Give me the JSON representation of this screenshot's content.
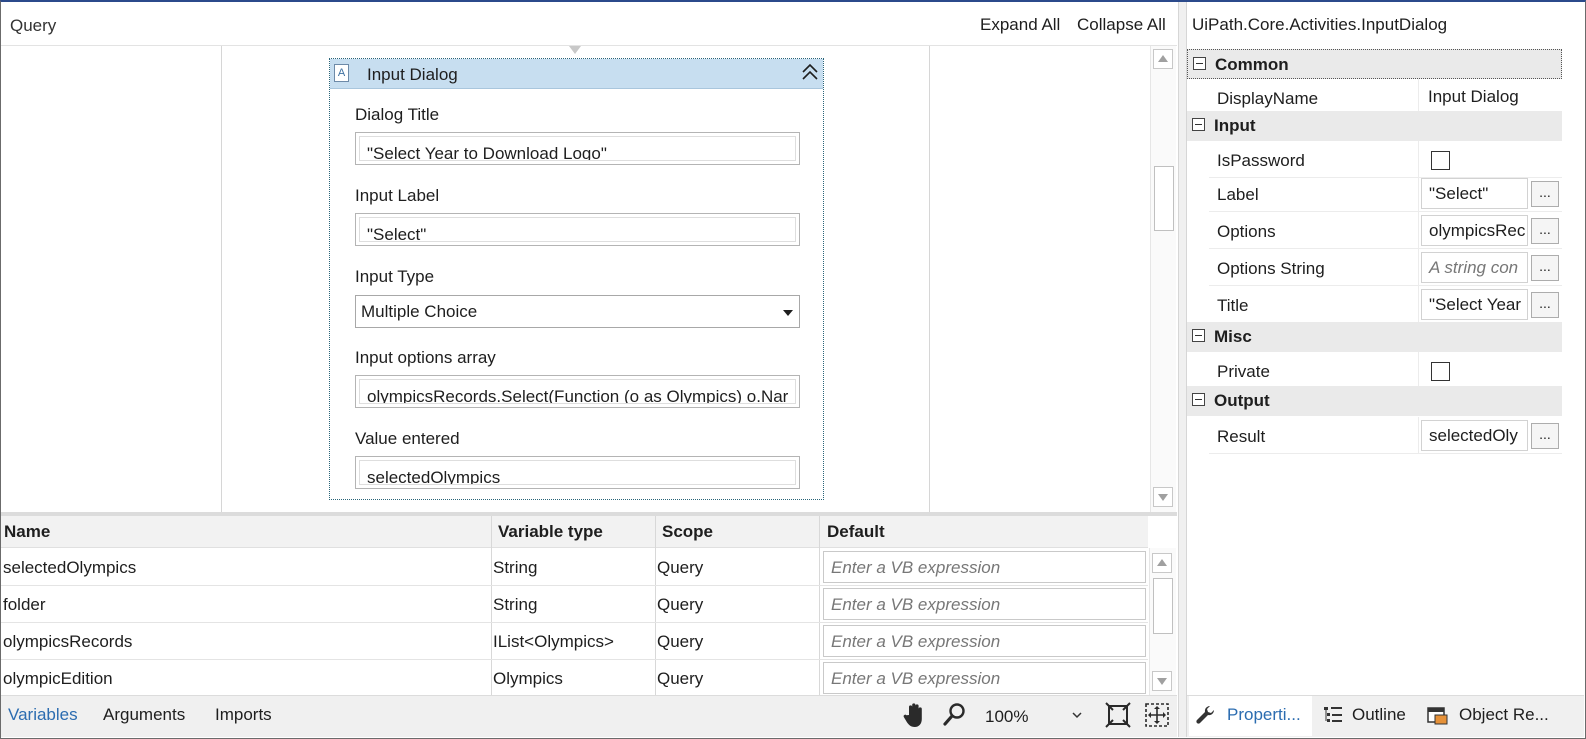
{
  "designer": {
    "title": "Query",
    "expand_all": "Expand All",
    "collapse_all": "Collapse All"
  },
  "activity": {
    "title": "Input Dialog",
    "icon": "input-dialog-icon",
    "fields": {
      "dialog_title_label": "Dialog Title",
      "dialog_title_value": "\"Select Year to Download Logo\"",
      "input_label_label": "Input Label",
      "input_label_value": "\"Select\"",
      "input_type_label": "Input Type",
      "input_type_value": "Multiple Choice",
      "options_label": "Input options array",
      "options_value": "olympicsRecords.Select(Function (o as Olympics) o.Nar",
      "value_entered_label": "Value entered",
      "value_entered_value": "selectedOlympics"
    }
  },
  "variables": {
    "columns": [
      "Name",
      "Variable type",
      "Scope",
      "Default"
    ],
    "rows": [
      {
        "name": "selectedOlympics",
        "type": "String",
        "scope": "Query",
        "default_placeholder": "Enter a VB expression"
      },
      {
        "name": "folder",
        "type": "String",
        "scope": "Query",
        "default_placeholder": "Enter a VB expression"
      },
      {
        "name": "olympicsRecords",
        "type": "IList<Olympics>",
        "scope": "Query",
        "default_placeholder": "Enter a VB expression"
      },
      {
        "name": "olympicEdition",
        "type": "Olympics",
        "scope": "Query",
        "default_placeholder": "Enter a VB expression"
      }
    ]
  },
  "bottom_tabs": {
    "variables": "Variables",
    "arguments": "Arguments",
    "imports": "Imports",
    "zoom": "100%"
  },
  "properties": {
    "title": "UiPath.Core.Activities.InputDialog",
    "categories": {
      "common": "Common",
      "input": "Input",
      "misc": "Misc",
      "output": "Output"
    },
    "rows": {
      "display_name": {
        "name": "DisplayName",
        "value": "Input Dialog"
      },
      "is_password": {
        "name": "IsPassword"
      },
      "label": {
        "name": "Label",
        "value": "\"Select\""
      },
      "options": {
        "name": "Options",
        "value": "olympicsRec"
      },
      "options_string": {
        "name": "Options String",
        "placeholder": "A string con"
      },
      "title": {
        "name": "Title",
        "value": "\"Select Year"
      },
      "private": {
        "name": "Private"
      },
      "result": {
        "name": "Result",
        "value": "selectedOly"
      }
    },
    "ellipsis": "..."
  },
  "props_tabs": {
    "properties": "Properti...",
    "outline": "Outline",
    "object_repo": "Object Re..."
  },
  "colors": {
    "accent": "#2b6cb0",
    "activity_header": "#c7def0",
    "frame_top": "#2b4a8b"
  }
}
